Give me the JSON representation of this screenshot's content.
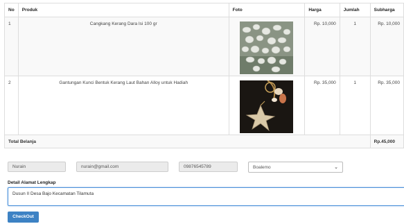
{
  "table": {
    "headers": {
      "no": "No",
      "produk": "Produk",
      "foto": "Foto",
      "harga": "Harga",
      "jumlah": "Jumlah",
      "subharga": "Subharga"
    },
    "rows": [
      {
        "no": "1",
        "produk": "Cangkang Kerang Dara Isi 100 gr",
        "harga": "Rp. 10,000",
        "jumlah": "1",
        "subharga": "Rp. 10,000"
      },
      {
        "no": "2",
        "produk": "Gantungan Kunci Bentuk Kerang Laut Bahan Alloy untuk Hadiah",
        "harga": "Rp. 35,000",
        "jumlah": "1",
        "subharga": "Rp. 35,000"
      }
    ],
    "total_label": "Total Belanja",
    "total_value": "Rp.45,000"
  },
  "form": {
    "name": "Nurain",
    "email": "nurain@gmail.com",
    "phone": "09876545789",
    "region": "Boalemo",
    "detail_label": "Detail Alamat Lengkap",
    "address": "Dusun II Desa Bajo Kecamatan Tilamuta",
    "checkout_label": "CheckOut"
  }
}
